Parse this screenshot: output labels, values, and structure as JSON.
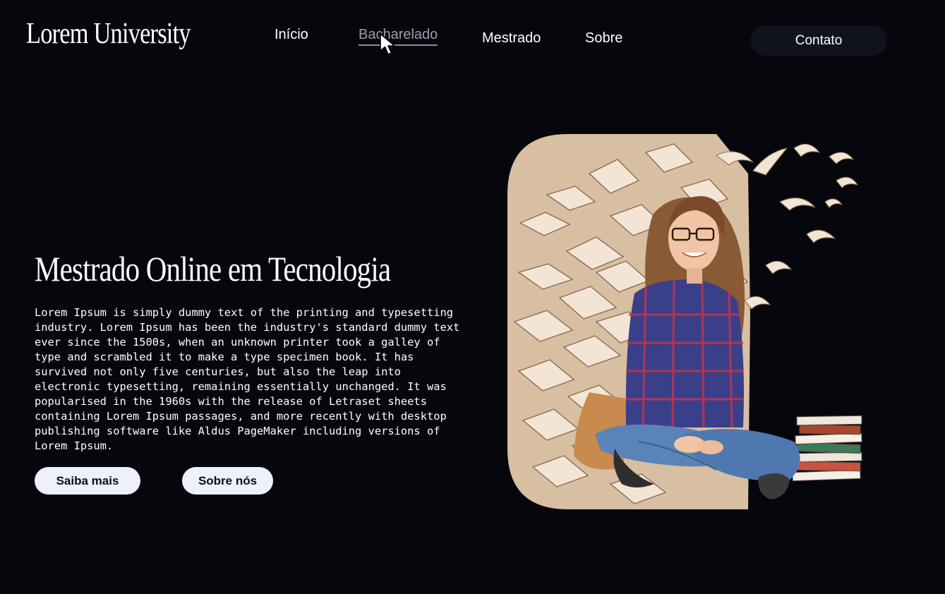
{
  "header": {
    "logo": "Lorem University",
    "nav": [
      {
        "label": "Início"
      },
      {
        "label": "Bacharelado"
      },
      {
        "label": "Mestrado"
      },
      {
        "label": "Sobre"
      }
    ],
    "contact_label": "Contato"
  },
  "hero": {
    "title": "Mestrado Online em Tecnologia",
    "body": "Lorem Ipsum is simply dummy text of the printing and typesetting industry. Lorem Ipsum has been the industry's standard dummy text ever since the 1500s, when an unknown printer took a galley of type and scrambled it to make a type specimen book. It has survived not only five centuries, but also the leap into electronic typesetting, remaining essentially unchanged. It was popularised in the 1960s with the release of Letraset sheets containing Lorem Ipsum passages, and more recently with desktop publishing software like Aldus PageMaker including versions of Lorem Ipsum.",
    "primary_button": "Saiba mais",
    "secondary_button": "Sobre nós"
  },
  "colors": {
    "background": "#06070d",
    "illustration_beige": "#d8bfa2",
    "paper": "#f2e5d5",
    "button_light": "#eef0fb"
  },
  "icons": {
    "cursor": "mouse-pointer-icon"
  }
}
